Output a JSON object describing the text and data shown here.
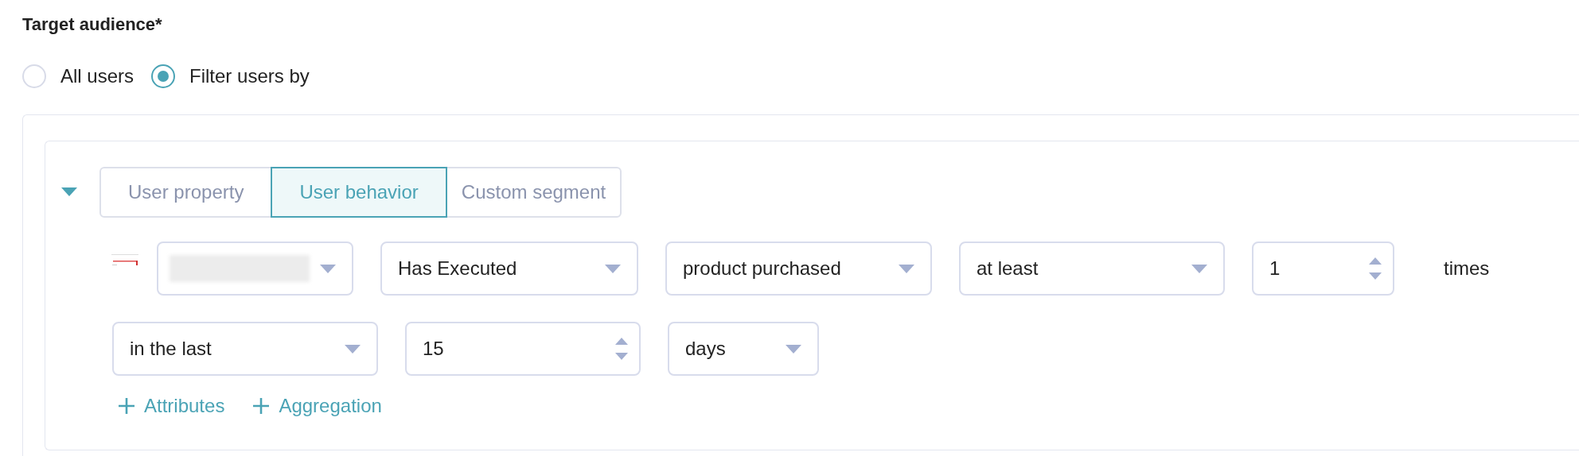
{
  "title": "Target audience*",
  "audience_options": [
    {
      "label": "All users",
      "selected": false
    },
    {
      "label": "Filter users by",
      "selected": true
    }
  ],
  "filter_group": {
    "expanded": true,
    "tabs": [
      {
        "label": "User property",
        "selected": false
      },
      {
        "label": "User behavior",
        "selected": true
      },
      {
        "label": "Custom segment",
        "selected": false
      }
    ],
    "event_condition": {
      "controls": [
        {
          "kind": "picture"
        },
        {
          "kind": "blurred"
        },
        {
          "kind": "select",
          "value": "Has Executed"
        },
        {
          "kind": "select",
          "value": "product purchased"
        },
        {
          "kind": "select",
          "value": "at least"
        },
        {
          "kind": "number",
          "value": "1"
        },
        {
          "kind": "text",
          "value": "times"
        }
      ]
    },
    "time_window": {
      "controls": [
        {
          "kind": "select",
          "value": "in the last"
        },
        {
          "kind": "number",
          "value": "15"
        },
        {
          "kind": "select",
          "value": "days"
        }
      ]
    },
    "links": [
      "Attributes",
      "Aggregation"
    ]
  }
}
